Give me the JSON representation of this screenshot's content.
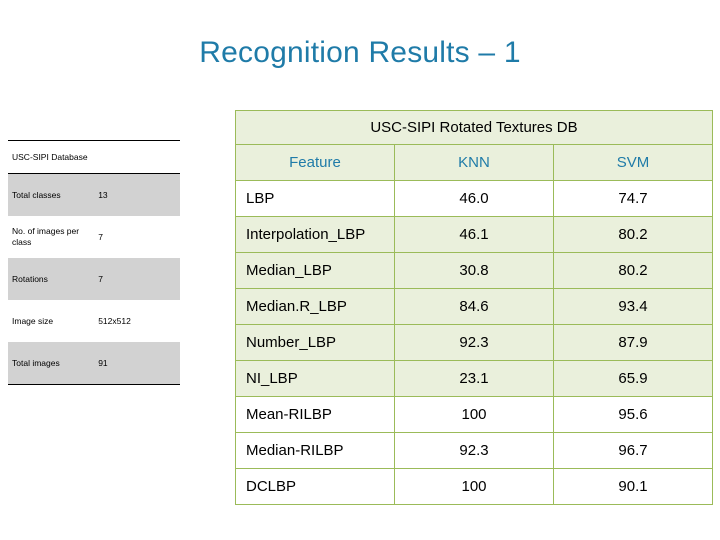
{
  "slide": {
    "title": "Recognition Results – 1",
    "title_color": "#1F7BA8"
  },
  "left_table": {
    "header_label": "USC-SIPI Database",
    "rows": [
      {
        "label": "Total classes",
        "value": "13",
        "shaded": true
      },
      {
        "label": "No. of images per class",
        "value": "7",
        "shaded": false
      },
      {
        "label": "Rotations",
        "value": "7",
        "shaded": true
      },
      {
        "label": "Image size",
        "value": "512x512",
        "shaded": false
      },
      {
        "label": "Total images",
        "value": "91",
        "shaded": true
      }
    ]
  },
  "main_table": {
    "title": "USC-SIPI Rotated Textures DB",
    "columns": [
      "Feature",
      "KNN",
      "SVM"
    ],
    "rows": [
      {
        "feature": "LBP",
        "knn": "46.0",
        "svm": "74.7",
        "highlight": false
      },
      {
        "feature": "Interpolation_LBP",
        "knn": "46.1",
        "svm": "80.2",
        "highlight": false
      },
      {
        "feature": "Median_LBP",
        "knn": "30.8",
        "svm": "80.2",
        "highlight": false
      },
      {
        "feature": "Median.R_LBP",
        "knn": "84.6",
        "svm": "93.4",
        "highlight": false
      },
      {
        "feature": "Number_LBP",
        "knn": "92.3",
        "svm": "87.9",
        "highlight": false
      },
      {
        "feature": "NI_LBP",
        "knn": "23.1",
        "svm": "65.9",
        "highlight": false
      },
      {
        "feature": "Mean-RILBP",
        "knn": "100",
        "svm": "95.6",
        "highlight": false
      },
      {
        "feature": "Median-RILBP",
        "knn": "92.3",
        "svm": "96.7",
        "highlight": false
      },
      {
        "feature": "DCLBP",
        "knn": "100",
        "svm": "90.1",
        "highlight": true
      }
    ],
    "border_color": "#9BBB59",
    "shade_color": "#EAF0DC",
    "header_text_color": "#1F7BA8",
    "highlight_color": "#C00000"
  }
}
